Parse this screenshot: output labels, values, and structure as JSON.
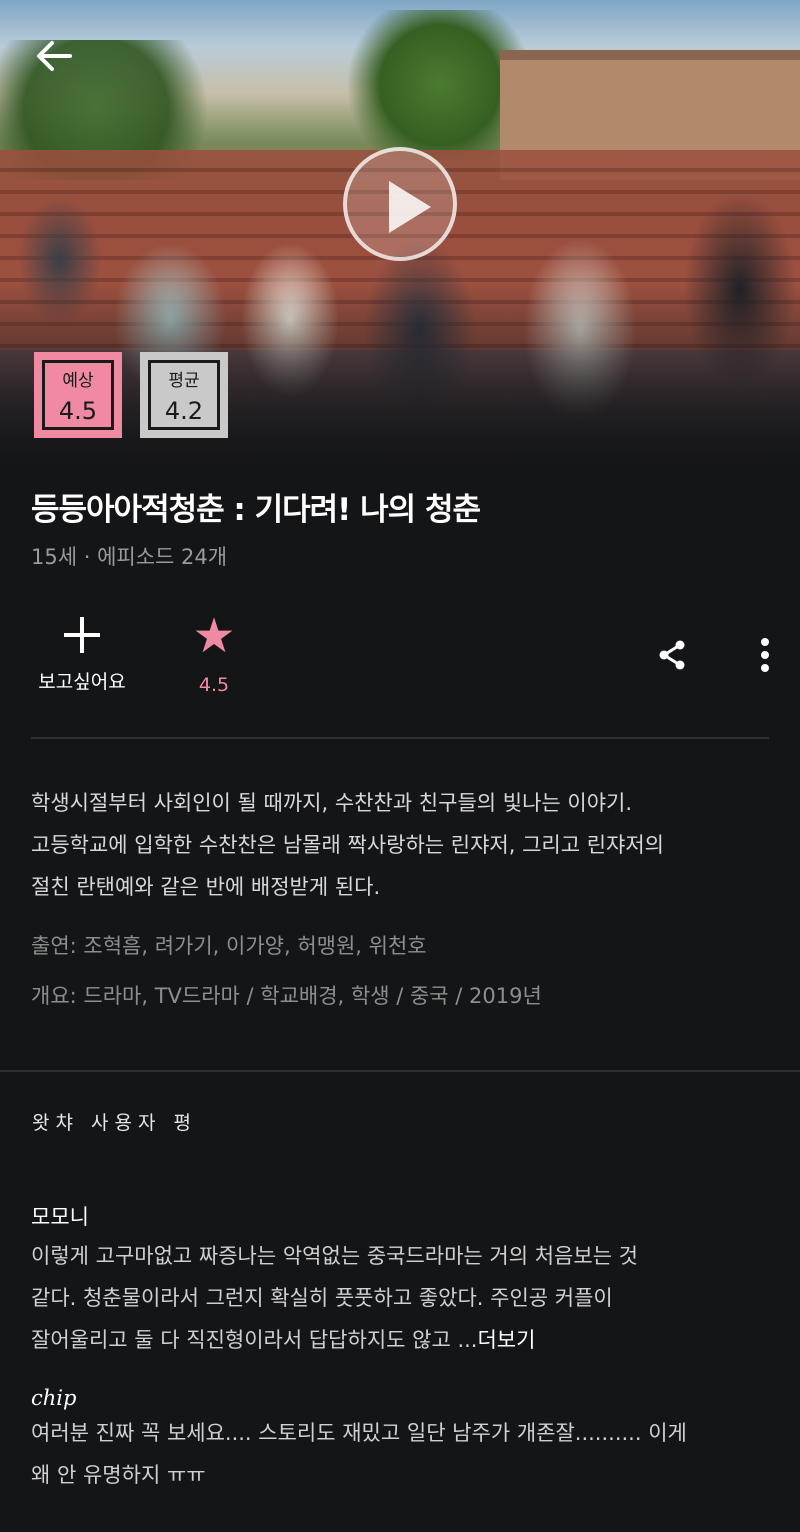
{
  "hero": {
    "ratings": [
      {
        "label": "예상",
        "value": "4.5"
      },
      {
        "label": "평균",
        "value": "4.2"
      }
    ]
  },
  "title": "등등아아적청춘 : 기다려! 나의 청춘",
  "meta": "15세 · 에피소드 24개",
  "actions": {
    "want_label": "보고싶어요",
    "rating_value": "4.5"
  },
  "description": [
    "학생시절부터 사회인이 될 때까지, 수찬찬과 친구들의 빛나는 이야기.",
    "고등학교에 입학한 수찬찬은 남몰래 짝사랑하는 린쟈저, 그리고 린쟈저의",
    "절친 란탠예와 같은 반에 배정받게 된다."
  ],
  "cast": "출연: 조혁흠, 려가기, 이가양, 허맹원, 위천호",
  "summary": "개요: 드라마, TV드라마 / 학교배경, 학생 / 중국 / 2019년",
  "reviews_section": {
    "title": "왓챠 사용자 평",
    "reviews": [
      {
        "author": "모모니",
        "lines": [
          "이렇게 고구마없고 짜증나는 악역없는 중국드라마는 거의 처음보는 것",
          "같다. 청춘물이라서 그런지 확실히 풋풋하고 좋았다. 주인공 커플이",
          "잘어울리고 둘 다 직진형이라서 답답하지도 않고 ..."
        ],
        "more_label": "더보기"
      },
      {
        "author": "chip",
        "lines": [
          "여러분 진짜 꼭 보세요.... 스토리도 재밌고 일단 남주가 개존잘.......... 이게",
          "왜 안 유명하지 ㅠㅠ"
        ]
      }
    ]
  },
  "colors": {
    "background": "#141517",
    "accent_pink": "#f08aa3",
    "muted_text": "#8e8e8e"
  }
}
